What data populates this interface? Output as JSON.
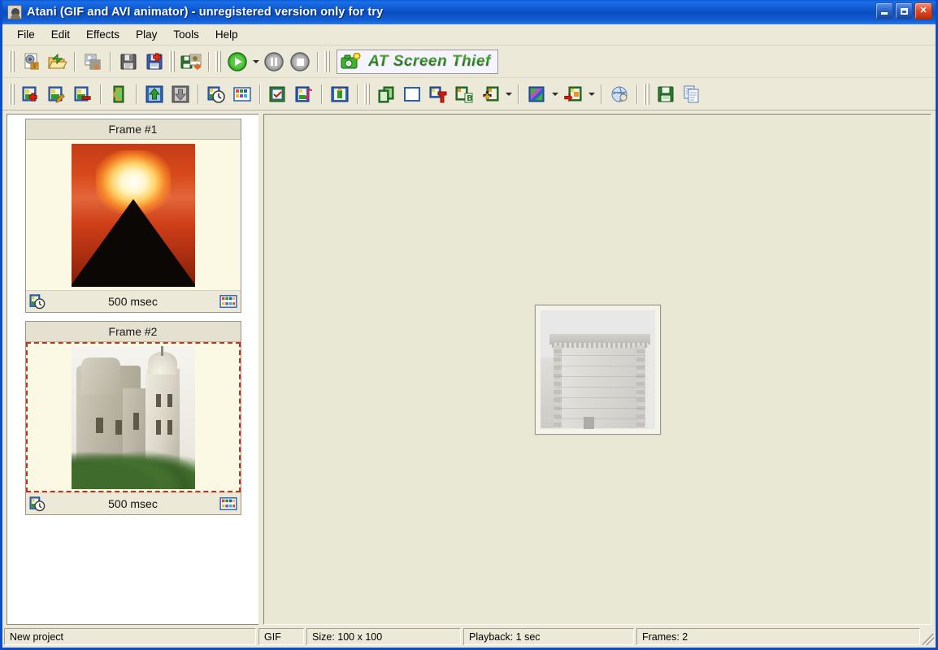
{
  "window": {
    "title": "Atani (GIF and AVI animator) - unregistered version only for try",
    "app_icon": "atani-head-icon",
    "controls": {
      "minimize": "Minimize",
      "maximize": "Maximize",
      "close": "Close"
    }
  },
  "menu": {
    "items": [
      {
        "label": "File"
      },
      {
        "label": "Edit"
      },
      {
        "label": "Effects"
      },
      {
        "label": "Play"
      },
      {
        "label": "Tools"
      },
      {
        "label": "Help"
      }
    ]
  },
  "toolbar_row1": {
    "buttons": [
      {
        "name": "new-animation-icon",
        "tooltip": "New animation"
      },
      {
        "name": "open-file-icon",
        "tooltip": "Open"
      },
      {
        "name": "import-film-icon",
        "tooltip": "Import images"
      },
      {
        "name": "save-icon",
        "tooltip": "Save"
      },
      {
        "name": "save-as-icon",
        "tooltip": "Save as"
      },
      {
        "name": "export-film-icon",
        "tooltip": "Export"
      },
      {
        "name": "play-icon",
        "tooltip": "Play"
      },
      {
        "name": "play-dropdown-icon",
        "tooltip": "Play options"
      },
      {
        "name": "pause-icon",
        "tooltip": "Pause"
      },
      {
        "name": "stop-icon",
        "tooltip": "Stop"
      }
    ],
    "banner": {
      "text": "AT Screen Thief",
      "icon": "camera-icon"
    }
  },
  "toolbar_row2": {
    "buttons": [
      {
        "name": "add-frame-icon",
        "tooltip": "Add frame"
      },
      {
        "name": "edit-frame-icon",
        "tooltip": "Edit frame"
      },
      {
        "name": "delete-frame-icon",
        "tooltip": "Delete frame"
      },
      {
        "name": "swap-frame-icon",
        "tooltip": "Swap frames"
      },
      {
        "name": "move-frame-up-icon",
        "tooltip": "Move frame up"
      },
      {
        "name": "move-frame-down-icon",
        "tooltip": "Move frame down"
      },
      {
        "name": "frame-delay-icon",
        "tooltip": "Frame delay"
      },
      {
        "name": "palette-icon",
        "tooltip": "Palette"
      },
      {
        "name": "select-frames-icon",
        "tooltip": "Select frames"
      },
      {
        "name": "frame-sound-icon",
        "tooltip": "Frame sound"
      },
      {
        "name": "frame-properties-icon",
        "tooltip": "Frame properties"
      },
      {
        "name": "duplicate-frames-icon",
        "tooltip": "Duplicate frames"
      },
      {
        "name": "crop-frame-icon",
        "tooltip": "Crop"
      },
      {
        "name": "insert-text-icon",
        "tooltip": "Insert text"
      },
      {
        "name": "insert-banner-icon",
        "tooltip": "Insert banner"
      },
      {
        "name": "insert-object-icon",
        "tooltip": "Insert object"
      },
      {
        "name": "insert-object-dropdown-icon",
        "tooltip": "Insert object options"
      },
      {
        "name": "transition-icon",
        "tooltip": "Transition effect"
      },
      {
        "name": "transition-dropdown-icon",
        "tooltip": "Transition options"
      },
      {
        "name": "effect-apply-icon",
        "tooltip": "Apply effect"
      },
      {
        "name": "effect-apply-dropdown-icon",
        "tooltip": "Effect options"
      },
      {
        "name": "optimize-icon",
        "tooltip": "Optimize"
      },
      {
        "name": "save-frame-icon",
        "tooltip": "Save frame"
      },
      {
        "name": "copy-frame-icon",
        "tooltip": "Copy frame"
      }
    ]
  },
  "frames": {
    "items": [
      {
        "title": "Frame #1",
        "delay": "500 msec",
        "selected": false,
        "artwork": "sunset-pyramid",
        "delay_icon": "frame-delay-icon",
        "palette_icon": "frame-palette-icon"
      },
      {
        "title": "Frame #2",
        "delay": "500 msec",
        "selected": true,
        "artwork": "cathedral-photo",
        "delay_icon": "frame-delay-icon",
        "palette_icon": "frame-palette-icon"
      }
    ]
  },
  "canvas": {
    "preview_artwork": "cathedral-cornice-faded",
    "preview_size": "100 x 100"
  },
  "statusbar": {
    "project": "New project",
    "format": "GIF",
    "size": "Size: 100 x 100",
    "playback": "Playback: 1 sec",
    "frames": "Frames: 2"
  },
  "colors": {
    "titlebar_blue": "#0d55cc",
    "face": "#ece9d8",
    "canvas_bg": "#e9e8d5",
    "selection_red": "#c4321c",
    "banner_green": "#3e9a2c"
  }
}
